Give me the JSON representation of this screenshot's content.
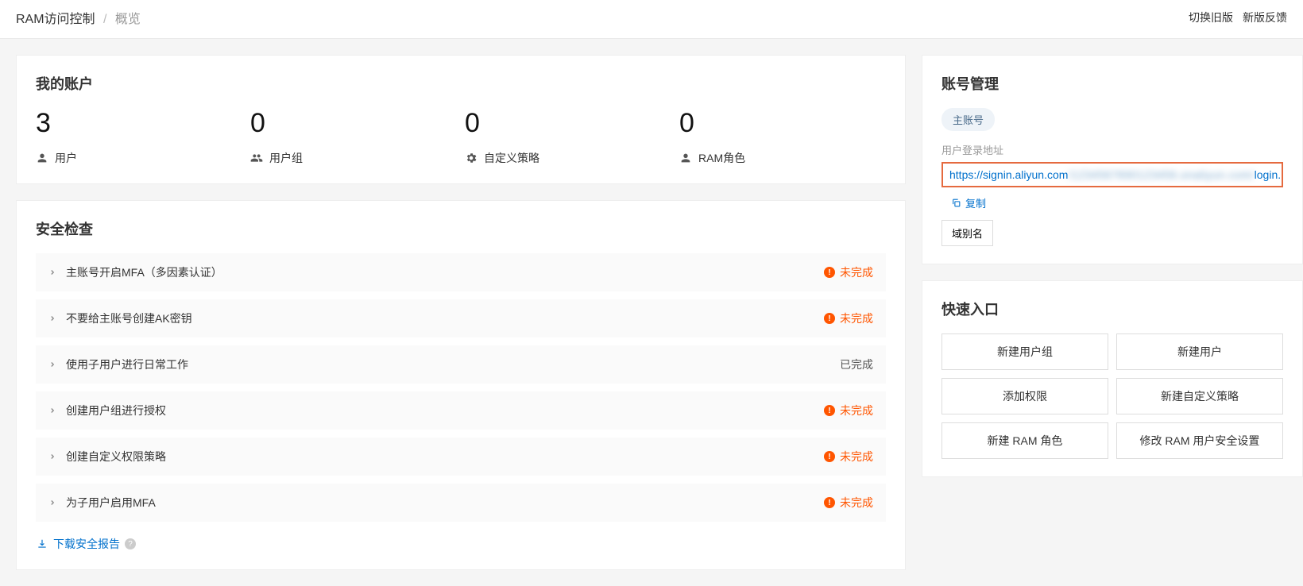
{
  "breadcrumb": {
    "root": "RAM访问控制",
    "current": "概览"
  },
  "topLinks": {
    "switchOld": "切换旧版",
    "feedback": "新版反馈"
  },
  "account": {
    "title": "我的账户",
    "stats": [
      {
        "value": "3",
        "label": "用户"
      },
      {
        "value": "0",
        "label": "用户组"
      },
      {
        "value": "0",
        "label": "自定义策略"
      },
      {
        "value": "0",
        "label": "RAM角色"
      }
    ]
  },
  "security": {
    "title": "安全检查",
    "items": [
      {
        "label": "主账号开启MFA（多因素认证）",
        "status": "未完成",
        "complete": false
      },
      {
        "label": "不要给主账号创建AK密钥",
        "status": "未完成",
        "complete": false
      },
      {
        "label": "使用子用户进行日常工作",
        "status": "已完成",
        "complete": true
      },
      {
        "label": "创建用户组进行授权",
        "status": "未完成",
        "complete": false
      },
      {
        "label": "创建自定义权限策略",
        "status": "未完成",
        "complete": false
      },
      {
        "label": "为子用户启用MFA",
        "status": "未完成",
        "complete": false
      }
    ],
    "download": "下载安全报告"
  },
  "accountMgmt": {
    "title": "账号管理",
    "badge": "主账号",
    "loginUrlLabel": "用户登录地址",
    "loginUrlPrefix": "https://signin.aliyun.com",
    "loginUrlHidden": "/1234567890123456.onaliyun.com/",
    "loginUrlSuffix": "login.htm",
    "copy": "复制",
    "domainAliasBtn": "域别名"
  },
  "quick": {
    "title": "快速入口",
    "buttons": [
      "新建用户组",
      "新建用户",
      "添加权限",
      "新建自定义策略",
      "新建 RAM 角色",
      "修改 RAM 用户安全设置"
    ]
  }
}
